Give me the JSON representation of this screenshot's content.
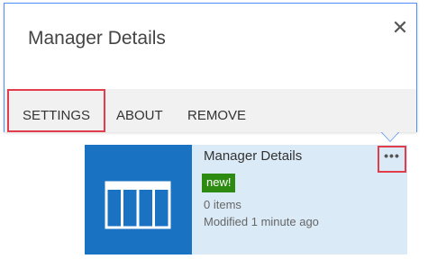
{
  "callout": {
    "title": "Manager Details",
    "close_icon": "close-icon",
    "actions": {
      "settings": "SETTINGS",
      "about": "ABOUT",
      "remove": "REMOVE"
    }
  },
  "tile": {
    "title": "Manager Details",
    "badge": "new!",
    "item_count": "0 items",
    "modified": "Modified 1 minute ago",
    "icon": "list-table-icon",
    "more_icon": "ellipsis-icon",
    "more_label": "•••"
  },
  "colors": {
    "tile_background": "#dbeaf7",
    "tile_image": "#1a72c2",
    "badge_green": "#2e8b12",
    "highlight_red": "#e33c4a",
    "callout_border": "#4d90fe",
    "action_bar": "#f1f1f1"
  }
}
